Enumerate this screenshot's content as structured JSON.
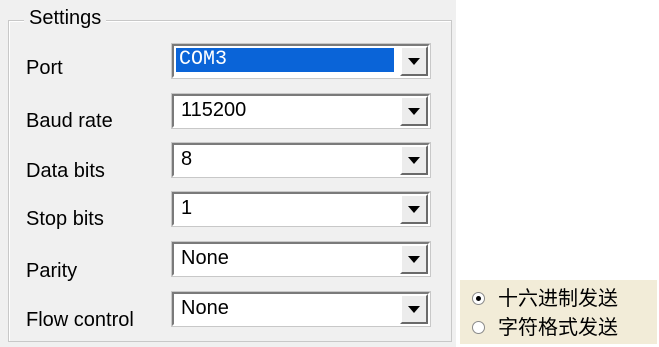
{
  "settings": {
    "title": "Settings",
    "rows": [
      {
        "label": "Port",
        "value": "COM3"
      },
      {
        "label": "Baud rate",
        "value": "115200"
      },
      {
        "label": "Data bits",
        "value": "8"
      },
      {
        "label": "Stop bits",
        "value": "1"
      },
      {
        "label": "Parity",
        "value": "None"
      },
      {
        "label": "Flow control",
        "value": "None"
      }
    ]
  },
  "send_mode": {
    "options": [
      {
        "label": "十六进制发送",
        "checked": true
      },
      {
        "label": "字符格式发送",
        "checked": false
      }
    ]
  },
  "colors": {
    "selection": "#0a64d8",
    "panel_bg": "#f0f0f0",
    "radio_bg": "#f2ecd8"
  }
}
